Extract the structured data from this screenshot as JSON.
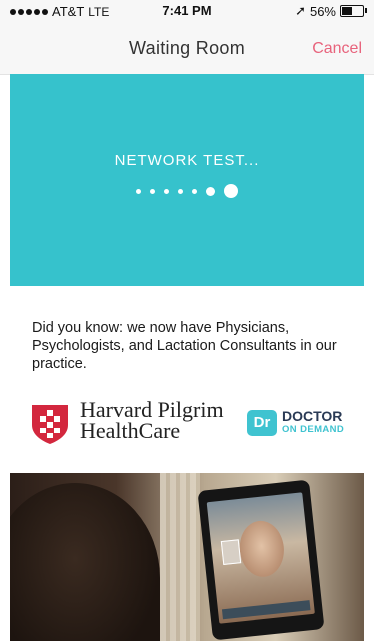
{
  "status_bar": {
    "carrier": "AT&T",
    "network": "LTE",
    "time": "7:41 PM",
    "location_glyph": "➚",
    "battery_percent": "56%",
    "battery_level": 0.56
  },
  "nav": {
    "title": "Waiting Room",
    "cancel_label": "Cancel",
    "accent_color": "#e8637c"
  },
  "network_test": {
    "label": "NETWORK TEST...",
    "background_color": "#36c2cc",
    "dots_total": 7,
    "active_dot": 7
  },
  "info": {
    "text": "Did you know: we now have Physicians, Psychologists, and Lactation Consultants in our practice."
  },
  "logos": {
    "harvard_line1": "Harvard Pilgrim",
    "harvard_line2": "HealthCare",
    "dr_badge": "Dr",
    "dr_title": "DOCTOR",
    "dr_subtitle": "ON DEMAND"
  },
  "photo": {
    "icon": "video-call-photo"
  }
}
